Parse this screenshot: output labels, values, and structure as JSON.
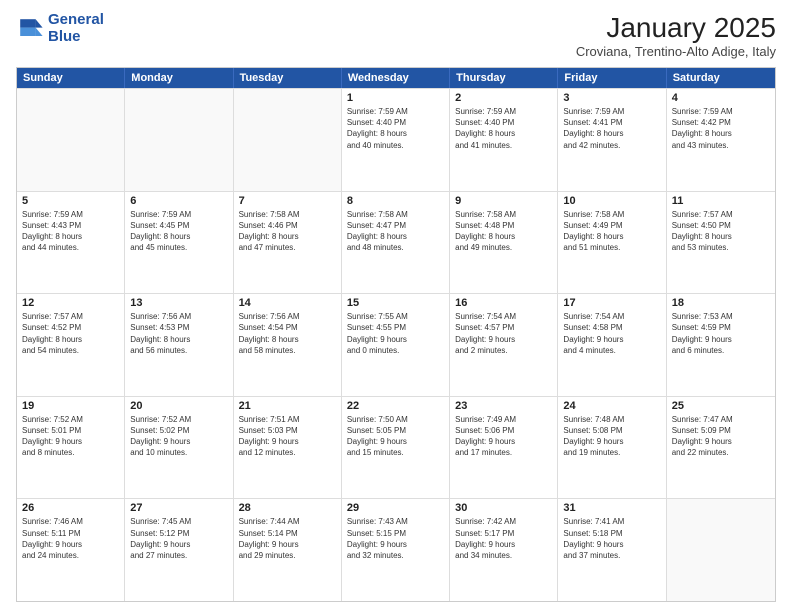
{
  "logo": {
    "line1": "General",
    "line2": "Blue"
  },
  "title": "January 2025",
  "location": "Croviana, Trentino-Alto Adige, Italy",
  "weekdays": [
    "Sunday",
    "Monday",
    "Tuesday",
    "Wednesday",
    "Thursday",
    "Friday",
    "Saturday"
  ],
  "rows": [
    [
      {
        "day": "",
        "detail": ""
      },
      {
        "day": "",
        "detail": ""
      },
      {
        "day": "",
        "detail": ""
      },
      {
        "day": "1",
        "detail": "Sunrise: 7:59 AM\nSunset: 4:40 PM\nDaylight: 8 hours\nand 40 minutes."
      },
      {
        "day": "2",
        "detail": "Sunrise: 7:59 AM\nSunset: 4:40 PM\nDaylight: 8 hours\nand 41 minutes."
      },
      {
        "day": "3",
        "detail": "Sunrise: 7:59 AM\nSunset: 4:41 PM\nDaylight: 8 hours\nand 42 minutes."
      },
      {
        "day": "4",
        "detail": "Sunrise: 7:59 AM\nSunset: 4:42 PM\nDaylight: 8 hours\nand 43 minutes."
      }
    ],
    [
      {
        "day": "5",
        "detail": "Sunrise: 7:59 AM\nSunset: 4:43 PM\nDaylight: 8 hours\nand 44 minutes."
      },
      {
        "day": "6",
        "detail": "Sunrise: 7:59 AM\nSunset: 4:45 PM\nDaylight: 8 hours\nand 45 minutes."
      },
      {
        "day": "7",
        "detail": "Sunrise: 7:58 AM\nSunset: 4:46 PM\nDaylight: 8 hours\nand 47 minutes."
      },
      {
        "day": "8",
        "detail": "Sunrise: 7:58 AM\nSunset: 4:47 PM\nDaylight: 8 hours\nand 48 minutes."
      },
      {
        "day": "9",
        "detail": "Sunrise: 7:58 AM\nSunset: 4:48 PM\nDaylight: 8 hours\nand 49 minutes."
      },
      {
        "day": "10",
        "detail": "Sunrise: 7:58 AM\nSunset: 4:49 PM\nDaylight: 8 hours\nand 51 minutes."
      },
      {
        "day": "11",
        "detail": "Sunrise: 7:57 AM\nSunset: 4:50 PM\nDaylight: 8 hours\nand 53 minutes."
      }
    ],
    [
      {
        "day": "12",
        "detail": "Sunrise: 7:57 AM\nSunset: 4:52 PM\nDaylight: 8 hours\nand 54 minutes."
      },
      {
        "day": "13",
        "detail": "Sunrise: 7:56 AM\nSunset: 4:53 PM\nDaylight: 8 hours\nand 56 minutes."
      },
      {
        "day": "14",
        "detail": "Sunrise: 7:56 AM\nSunset: 4:54 PM\nDaylight: 8 hours\nand 58 minutes."
      },
      {
        "day": "15",
        "detail": "Sunrise: 7:55 AM\nSunset: 4:55 PM\nDaylight: 9 hours\nand 0 minutes."
      },
      {
        "day": "16",
        "detail": "Sunrise: 7:54 AM\nSunset: 4:57 PM\nDaylight: 9 hours\nand 2 minutes."
      },
      {
        "day": "17",
        "detail": "Sunrise: 7:54 AM\nSunset: 4:58 PM\nDaylight: 9 hours\nand 4 minutes."
      },
      {
        "day": "18",
        "detail": "Sunrise: 7:53 AM\nSunset: 4:59 PM\nDaylight: 9 hours\nand 6 minutes."
      }
    ],
    [
      {
        "day": "19",
        "detail": "Sunrise: 7:52 AM\nSunset: 5:01 PM\nDaylight: 9 hours\nand 8 minutes."
      },
      {
        "day": "20",
        "detail": "Sunrise: 7:52 AM\nSunset: 5:02 PM\nDaylight: 9 hours\nand 10 minutes."
      },
      {
        "day": "21",
        "detail": "Sunrise: 7:51 AM\nSunset: 5:03 PM\nDaylight: 9 hours\nand 12 minutes."
      },
      {
        "day": "22",
        "detail": "Sunrise: 7:50 AM\nSunset: 5:05 PM\nDaylight: 9 hours\nand 15 minutes."
      },
      {
        "day": "23",
        "detail": "Sunrise: 7:49 AM\nSunset: 5:06 PM\nDaylight: 9 hours\nand 17 minutes."
      },
      {
        "day": "24",
        "detail": "Sunrise: 7:48 AM\nSunset: 5:08 PM\nDaylight: 9 hours\nand 19 minutes."
      },
      {
        "day": "25",
        "detail": "Sunrise: 7:47 AM\nSunset: 5:09 PM\nDaylight: 9 hours\nand 22 minutes."
      }
    ],
    [
      {
        "day": "26",
        "detail": "Sunrise: 7:46 AM\nSunset: 5:11 PM\nDaylight: 9 hours\nand 24 minutes."
      },
      {
        "day": "27",
        "detail": "Sunrise: 7:45 AM\nSunset: 5:12 PM\nDaylight: 9 hours\nand 27 minutes."
      },
      {
        "day": "28",
        "detail": "Sunrise: 7:44 AM\nSunset: 5:14 PM\nDaylight: 9 hours\nand 29 minutes."
      },
      {
        "day": "29",
        "detail": "Sunrise: 7:43 AM\nSunset: 5:15 PM\nDaylight: 9 hours\nand 32 minutes."
      },
      {
        "day": "30",
        "detail": "Sunrise: 7:42 AM\nSunset: 5:17 PM\nDaylight: 9 hours\nand 34 minutes."
      },
      {
        "day": "31",
        "detail": "Sunrise: 7:41 AM\nSunset: 5:18 PM\nDaylight: 9 hours\nand 37 minutes."
      },
      {
        "day": "",
        "detail": ""
      }
    ]
  ]
}
